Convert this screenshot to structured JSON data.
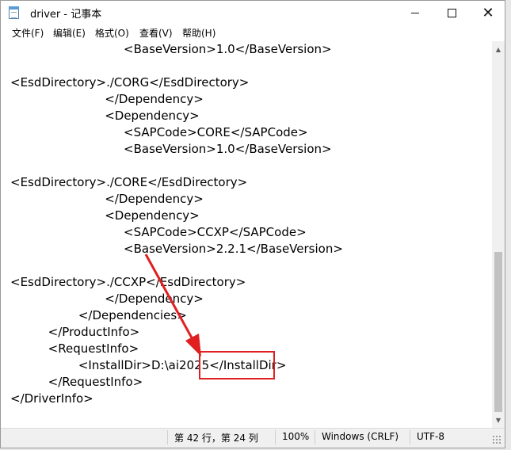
{
  "window": {
    "title": "driver - 记事本",
    "controls": {
      "minimize": "—",
      "maximize": "☐",
      "close": "✕"
    }
  },
  "menubar": {
    "items": [
      {
        "label": "文件(F)"
      },
      {
        "label": "编辑(E)"
      },
      {
        "label": "格式(O)"
      },
      {
        "label": "查看(V)"
      },
      {
        "label": "帮助(H)"
      }
    ]
  },
  "editor": {
    "lines": [
      "                              <BaseVersion>1.0</BaseVersion>",
      "",
      "<EsdDirectory>./CORG</EsdDirectory>",
      "                         </Dependency>",
      "                         <Dependency>",
      "                              <SAPCode>CORE</SAPCode>",
      "                              <BaseVersion>1.0</BaseVersion>",
      "",
      "<EsdDirectory>./CORE</EsdDirectory>",
      "                         </Dependency>",
      "                         <Dependency>",
      "                              <SAPCode>CCXP</SAPCode>",
      "                              <BaseVersion>2.2.1</BaseVersion>",
      "",
      "<EsdDirectory>./CCXP</EsdDirectory>",
      "                         </Dependency>",
      "                  </Dependencies>",
      "          </ProductInfo>",
      "          <RequestInfo>",
      "                  <InstallDir>D:\\ai2025</InstallDir>",
      "          </RequestInfo>",
      "</DriverInfo>"
    ]
  },
  "statusbar": {
    "position": "第 42 行，第 24 列",
    "zoom": "100%",
    "line_ending": "Windows (CRLF)",
    "encoding": "UTF-8"
  },
  "colors": {
    "annotation": "#e02020"
  }
}
